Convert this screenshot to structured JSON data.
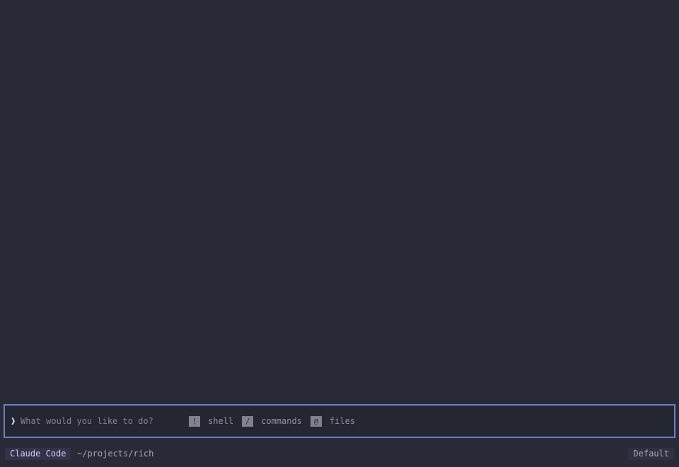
{
  "prompt": {
    "caret": "❱",
    "placeholder": "What would you like to do?",
    "value": "",
    "hints": [
      {
        "key": "!",
        "label": "shell"
      },
      {
        "key": "/",
        "label": "commands"
      },
      {
        "key": "@",
        "label": "files"
      }
    ]
  },
  "statusbar": {
    "app_name": "Claude Code",
    "cwd": "~/projects/rich",
    "mode": "Default"
  },
  "colors": {
    "background": "#282b37",
    "prompt_border": "#6d7fbf",
    "app_badge_text": "#d8ccef"
  }
}
